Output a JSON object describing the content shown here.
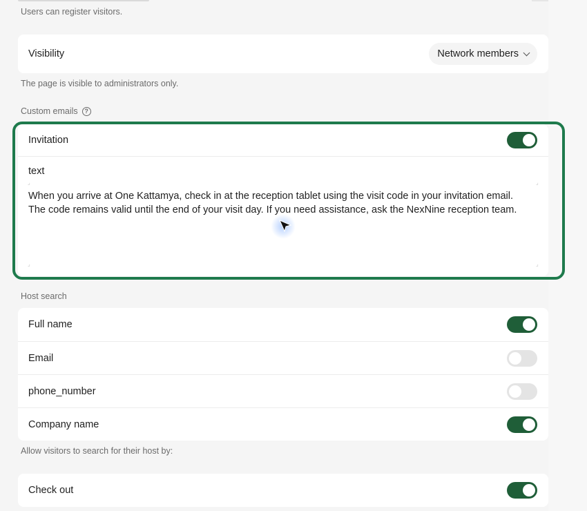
{
  "register_helper": "Users can register visitors.",
  "visibility": {
    "label": "Visibility",
    "selected": "Network members",
    "helper": "The page is visible to administrators only."
  },
  "custom_emails": {
    "label": "Custom emails",
    "help_icon": "question-circle-icon",
    "invitation": {
      "label": "Invitation",
      "enabled": true,
      "text_label": "text",
      "text_value": "When you arrive at One Kattamya, check in at the reception tablet using the visit code in your invitation email.\nThe code remains valid until the end of your visit day. If you need assistance, ask the NexNine reception team."
    }
  },
  "host_search": {
    "label": "Host search",
    "items": [
      {
        "label": "Full name",
        "enabled": true
      },
      {
        "label": "Email",
        "enabled": false
      },
      {
        "label": "phone_number",
        "enabled": false
      },
      {
        "label": "Company name",
        "enabled": true
      }
    ],
    "helper": "Allow visitors to search for their host by:"
  },
  "check_out": {
    "label": "Check out",
    "enabled": true
  },
  "colors": {
    "toggle_on": "#1f5e38",
    "toggle_off": "#e4e4e4",
    "highlight": "#1e7a4c"
  }
}
